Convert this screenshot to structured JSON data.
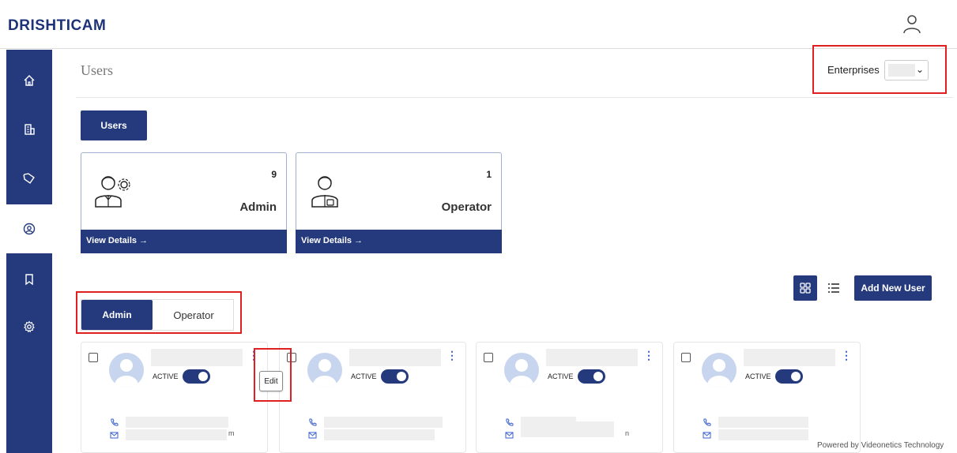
{
  "app": {
    "logo": "DRISHTICAM"
  },
  "page": {
    "title": "Users"
  },
  "enterprise": {
    "label": "Enterprises",
    "selected": ""
  },
  "sidebar": {
    "items": [
      {
        "icon": "home-icon"
      },
      {
        "icon": "building-icon"
      },
      {
        "icon": "tag-icon"
      },
      {
        "icon": "user-circle-icon",
        "active": true
      },
      {
        "icon": "bookmark-icon"
      },
      {
        "icon": "gear-icon"
      }
    ]
  },
  "tabs": {
    "users": "Users"
  },
  "stats": [
    {
      "count": "9",
      "name": "Admin",
      "link": "View Details →"
    },
    {
      "count": "1",
      "name": "Operator",
      "link": "View Details →"
    }
  ],
  "toolbar": {
    "add_user": "Add New User"
  },
  "segment": {
    "admin": "Admin",
    "operator": "Operator"
  },
  "user_cards": [
    {
      "status": "ACTIVE",
      "email_tail": "m"
    },
    {
      "status": "ACTIVE",
      "email_tail": ""
    },
    {
      "status": "ACTIVE",
      "email_tail": "n"
    },
    {
      "status": "ACTIVE",
      "email_tail": ""
    }
  ],
  "context_menu": {
    "edit": "Edit"
  },
  "footer": {
    "powered": "Powered by Videonetics Technology"
  },
  "colors": {
    "primary": "#243a7d",
    "highlight": "#e02020"
  }
}
